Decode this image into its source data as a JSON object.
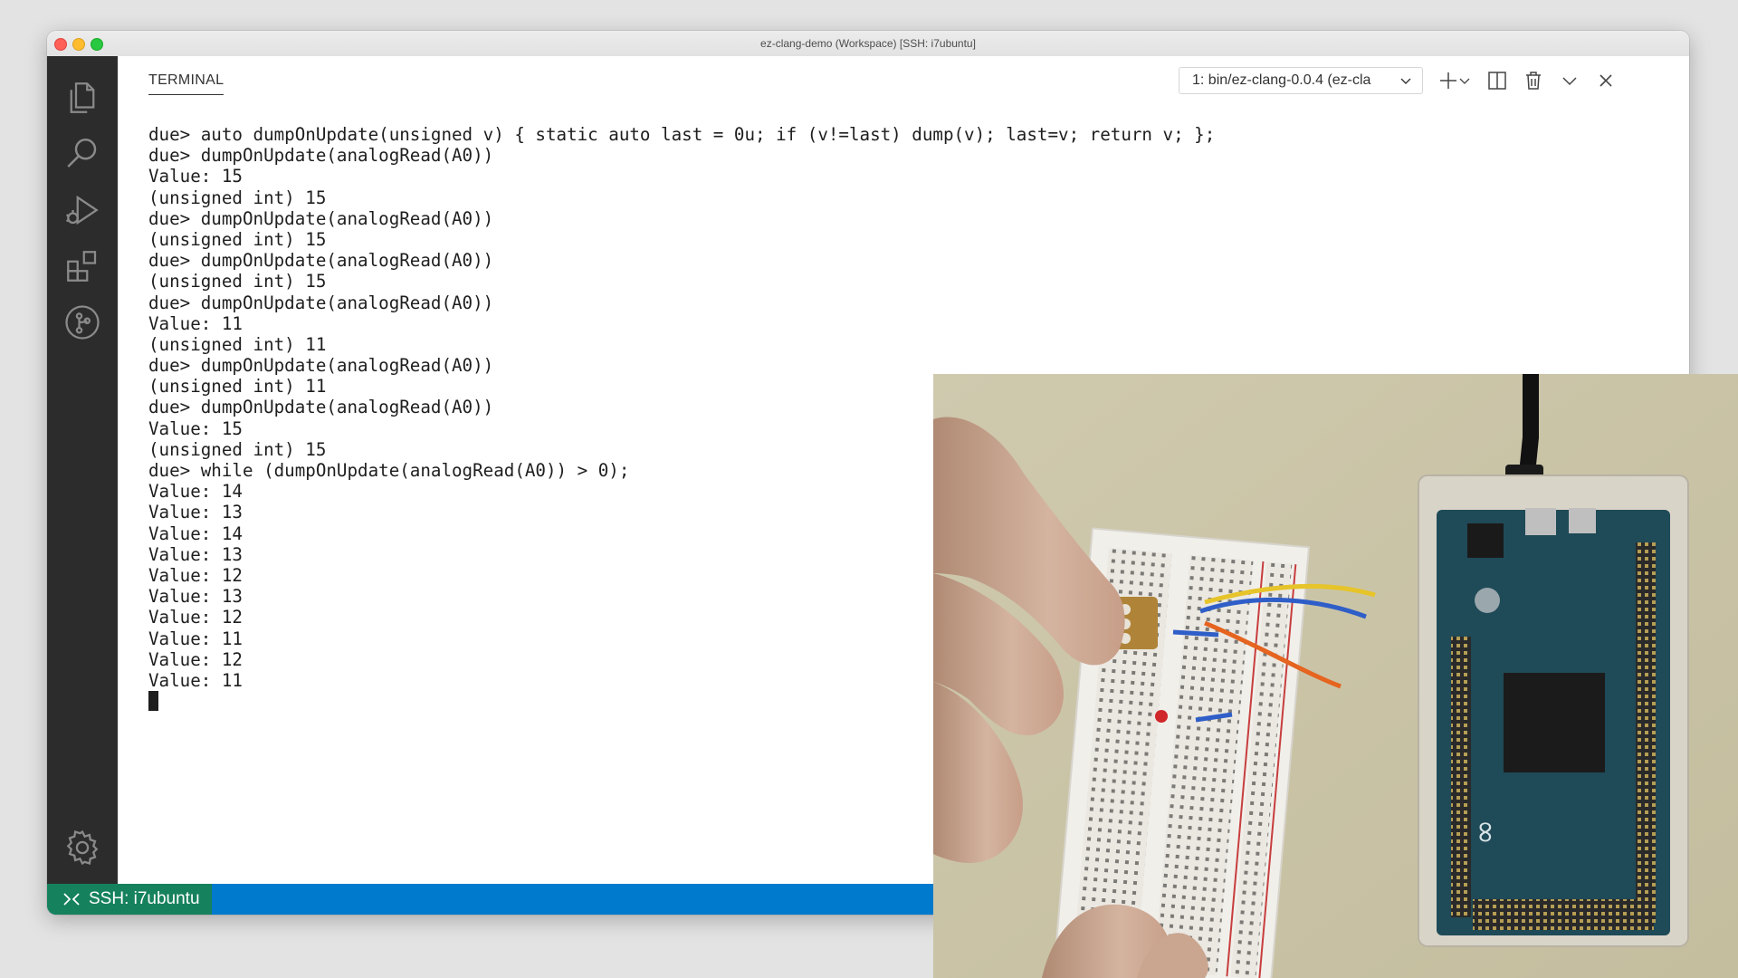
{
  "window": {
    "title": "ez-clang-demo (Workspace) [SSH: i7ubuntu]"
  },
  "activity_bar": {
    "icons": [
      "explorer-icon",
      "search-icon",
      "run-debug-icon",
      "extensions-icon",
      "source-control-icon",
      "gear-icon"
    ]
  },
  "panel": {
    "tab_label": "TERMINAL",
    "terminal_select": "1: bin/ez-clang-0.0.4 (ez-cla",
    "actions": [
      "plus-icon",
      "chevron-down-icon",
      "split-icon",
      "trash-icon",
      "chevron-down-icon",
      "close-icon"
    ]
  },
  "terminal": {
    "lines": [
      "due> auto dumpOnUpdate(unsigned v) { static auto last = 0u; if (v!=last) dump(v); last=v; return v; };",
      "due> dumpOnUpdate(analogRead(A0))",
      "Value: 15",
      "(unsigned int) 15",
      "due> dumpOnUpdate(analogRead(A0))",
      "(unsigned int) 15",
      "due> dumpOnUpdate(analogRead(A0))",
      "(unsigned int) 15",
      "due> dumpOnUpdate(analogRead(A0))",
      "Value: 11",
      "(unsigned int) 11",
      "due> dumpOnUpdate(analogRead(A0))",
      "(unsigned int) 11",
      "due> dumpOnUpdate(analogRead(A0))",
      "Value: 15",
      "(unsigned int) 15",
      "due> while (dumpOnUpdate(analogRead(A0)) > 0);",
      "Value: 14",
      "Value: 13",
      "Value: 14",
      "Value: 13",
      "Value: 12",
      "Value: 13",
      "Value: 12",
      "Value: 11",
      "Value: 12",
      "Value: 11"
    ]
  },
  "statusbar": {
    "remote_label": "SSH: i7ubuntu",
    "bg_color": "#007acc",
    "remote_color": "#16825d"
  },
  "video_overlay": {
    "subject": "hand-adjusting-potentiometer-on-breadboard-with-arduino-due"
  }
}
